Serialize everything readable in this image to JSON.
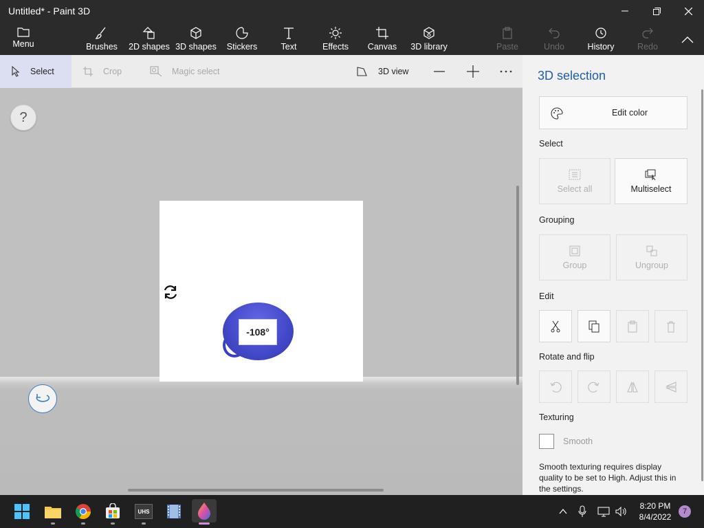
{
  "window": {
    "title": "Untitled* - Paint 3D",
    "controls": {
      "minimize": "—",
      "maximize": "❐",
      "close": "✕"
    }
  },
  "ribbon": {
    "menu": "Menu",
    "tools": [
      {
        "label": "Brushes",
        "icon": "brush-icon"
      },
      {
        "label": "2D shapes",
        "icon": "2d-shapes-icon"
      },
      {
        "label": "3D shapes",
        "icon": "3d-shapes-icon"
      },
      {
        "label": "Stickers",
        "icon": "stickers-icon"
      },
      {
        "label": "Text",
        "icon": "text-icon"
      },
      {
        "label": "Effects",
        "icon": "effects-icon"
      },
      {
        "label": "Canvas",
        "icon": "canvas-icon"
      },
      {
        "label": "3D library",
        "icon": "3d-library-icon"
      }
    ],
    "actions": [
      {
        "label": "Paste",
        "enabled": false
      },
      {
        "label": "Undo",
        "enabled": false
      },
      {
        "label": "History",
        "enabled": true
      },
      {
        "label": "Redo",
        "enabled": false
      }
    ]
  },
  "toolbar": {
    "select": "Select",
    "crop": "Crop",
    "magic_select": "Magic select",
    "view_3d": "3D view",
    "zoom_out": "—",
    "zoom_in": "+",
    "more": "···"
  },
  "canvas": {
    "help": "?",
    "rotation_angle": "-108°"
  },
  "panel": {
    "title": "3D selection",
    "edit_color": "Edit color",
    "select_heading": "Select",
    "select_all": "Select all",
    "multiselect": "Multiselect",
    "grouping_heading": "Grouping",
    "group": "Group",
    "ungroup": "Ungroup",
    "edit_heading": "Edit",
    "rotate_heading": "Rotate and flip",
    "texturing_heading": "Texturing",
    "smooth": "Smooth",
    "smooth_checked": false,
    "note": "Smooth texturing requires display quality to be set to High. Adjust this in the settings."
  },
  "taskbar": {
    "time": "8:20 PM",
    "date": "8/4/2022",
    "notification_count": "7",
    "vhs_label": "UHS"
  },
  "colors": {
    "accent": "#1f5fa8",
    "ribbon_bg": "#2b2b2b",
    "object": "#4348c9"
  }
}
